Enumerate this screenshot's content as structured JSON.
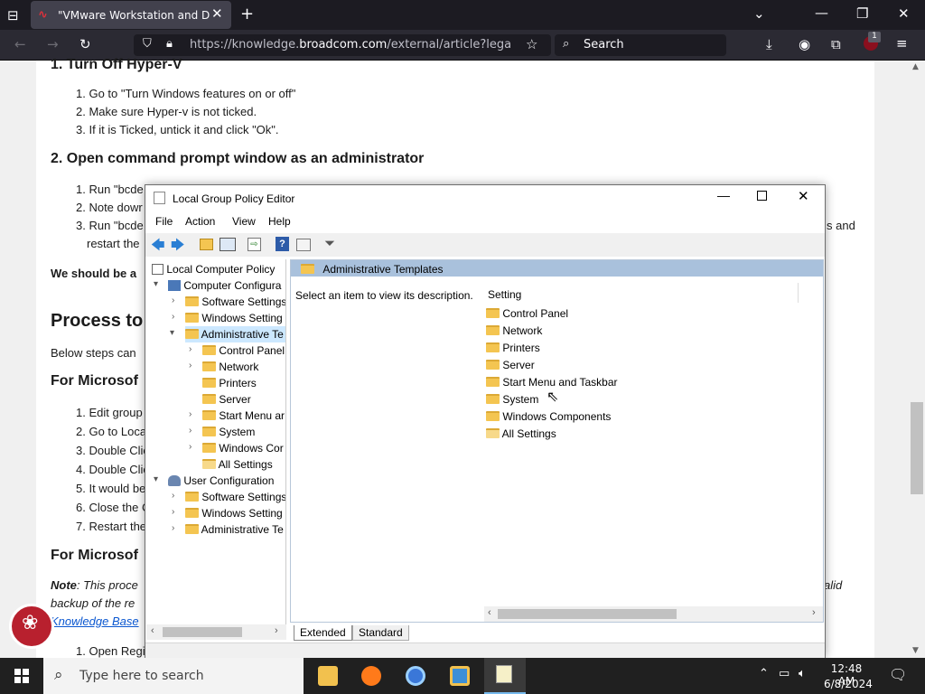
{
  "browser": {
    "tab_title": "\"VMware Workstation and Devic",
    "url_prefix": "https://knowledge.",
    "url_domain": "broadcom.com",
    "url_suffix": "/external/article?legacyId",
    "search_label": "Search",
    "badge_count": "1"
  },
  "article": {
    "h_turn_off": "1. Turn Off Hyper-V",
    "steps1": [
      "1. Go to \"Turn Windows features on or off\"",
      "2. Make sure Hyper-v is not ticked.",
      "3. If it is Ticked, untick it and click \"Ok\"."
    ],
    "h_cmd": "2. Open command prompt window as an administrator",
    "steps2": [
      "1. Run \"bcde",
      "2. Note dowr",
      "3. Run \"bcde"
    ],
    "restart_frag": "restart the",
    "s_and": "s and",
    "should_frag": "We should be a",
    "process_frag": "Process to",
    "below_frag": "Below steps can",
    "ms1_frag": "For Microsof",
    "steps3": [
      "1. Edit group",
      "2. Go to Loca",
      "3. Double Clic",
      "4. Double Clic",
      "5. It would be",
      "6. Close the C",
      "7. Restart the"
    ],
    "ms2_frag": "For Microsof",
    "note_label": "Note",
    "note_frag": ": This proce",
    "valid_frag": "alid",
    "backup_frag": "backup of the re",
    "kb_frag": "Knowledge Base",
    "open_frag": "1. Open Regis"
  },
  "gpedit": {
    "title": "Local Group Policy Editor",
    "menu": [
      "File",
      "Action",
      "View",
      "Help"
    ],
    "tree": [
      {
        "label": "Local Computer Policy"
      },
      {
        "label": "Computer Configura"
      },
      {
        "label": "Software Settings"
      },
      {
        "label": "Windows Setting"
      },
      {
        "label": "Administrative Te"
      },
      {
        "label": "Control Panel"
      },
      {
        "label": "Network"
      },
      {
        "label": "Printers"
      },
      {
        "label": "Server"
      },
      {
        "label": "Start Menu ar"
      },
      {
        "label": "System"
      },
      {
        "label": "Windows Cor"
      },
      {
        "label": "All Settings"
      },
      {
        "label": "User Configuration"
      },
      {
        "label": "Software Settings"
      },
      {
        "label": "Windows Setting"
      },
      {
        "label": "Administrative Te"
      }
    ],
    "header_title": "Administrative Templates",
    "description": "Select an item to view its description.",
    "col_setting": "Setting",
    "items": [
      "Control Panel",
      "Network",
      "Printers",
      "Server",
      "Start Menu and Taskbar",
      "System",
      "Windows Components",
      "All Settings"
    ],
    "tab_extended": "Extended",
    "tab_standard": "Standard"
  },
  "taskbar": {
    "search_placeholder": "Type here to search",
    "time": "12:48 AM",
    "date": "6/8/2024"
  }
}
